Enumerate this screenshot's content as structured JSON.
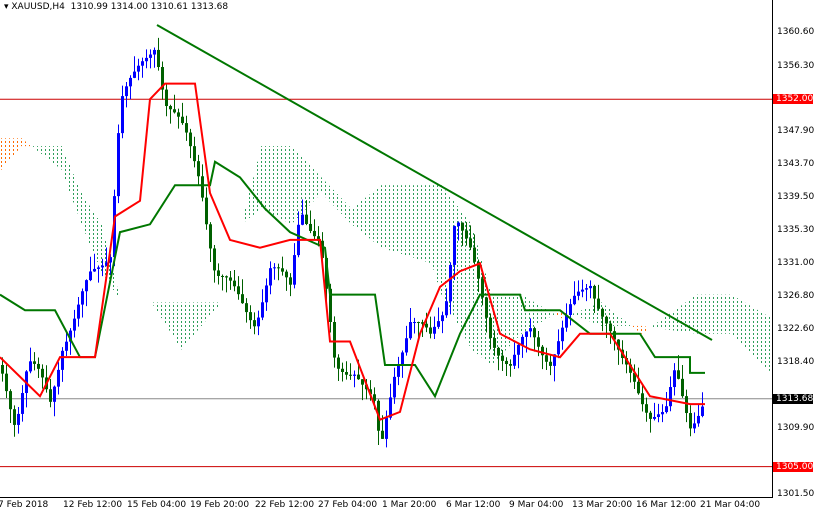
{
  "header": {
    "symbol": "XAUUSD,H4",
    "ohlc": "1310.99 1314.00 1310.61 1313.68"
  },
  "chart_data": {
    "type": "candlestick",
    "title": "XAUUSD,H4",
    "ylim": [
      1301.5,
      1360.6
    ],
    "y_ticks": [
      "1360.60",
      "1356.30",
      "1347.90",
      "1343.70",
      "1339.50",
      "1335.30",
      "1331.00",
      "1326.80",
      "1322.60",
      "1318.40",
      "1309.90",
      "1301.50"
    ],
    "x_ticks": [
      "7 Feb 2018",
      "12 Feb 12:00",
      "15 Feb 04:00",
      "19 Feb 20:00",
      "22 Feb 12:00",
      "27 Feb 04:00",
      "1 Mar 20:00",
      "6 Mar 12:00",
      "9 Mar 04:00",
      "13 Mar 20:00",
      "16 Mar 12:00",
      "21 Mar 04:00"
    ],
    "levels": [
      {
        "label": "1352.00",
        "value": 1352.0,
        "color": "#ff0000"
      },
      {
        "label": "1305.00",
        "value": 1305.0,
        "color": "#ff0000"
      },
      {
        "label": "1313.68",
        "value": 1313.68,
        "color": "#000000"
      }
    ],
    "trendline": {
      "from": 1361.5,
      "to": 1321.2,
      "color": "#007700"
    },
    "price_path": [
      [
        0,
        1318
      ],
      [
        5,
        1316
      ],
      [
        15,
        1311
      ],
      [
        28,
        1318
      ],
      [
        40,
        1316
      ],
      [
        50,
        1313.5
      ],
      [
        62,
        1321
      ],
      [
        75,
        1324
      ],
      [
        90,
        1329
      ],
      [
        110,
        1333
      ],
      [
        120,
        1352
      ],
      [
        135,
        1354.5
      ],
      [
        155,
        1359.6
      ],
      [
        165,
        1352
      ],
      [
        185,
        1347
      ],
      [
        200,
        1342
      ],
      [
        215,
        1330
      ],
      [
        240,
        1326
      ],
      [
        255,
        1324
      ],
      [
        270,
        1330
      ],
      [
        290,
        1328
      ],
      [
        300,
        1339
      ],
      [
        320,
        1333
      ],
      [
        335,
        1317
      ],
      [
        355,
        1318
      ],
      [
        375,
        1312
      ],
      [
        380,
        1306
      ],
      [
        395,
        1318
      ],
      [
        410,
        1324
      ],
      [
        430,
        1321
      ],
      [
        445,
        1326
      ],
      [
        455,
        1338
      ],
      [
        470,
        1332
      ],
      [
        490,
        1322
      ],
      [
        510,
        1318
      ],
      [
        530,
        1322
      ],
      [
        550,
        1319
      ],
      [
        575,
        1326
      ],
      [
        590,
        1329
      ],
      [
        605,
        1324
      ],
      [
        620,
        1318
      ],
      [
        635,
        1316
      ],
      [
        650,
        1312
      ],
      [
        665,
        1311
      ],
      [
        675,
        1317
      ],
      [
        690,
        1311
      ],
      [
        705,
        1313.7
      ]
    ],
    "kijun": [
      [
        0,
        1327
      ],
      [
        25,
        1325
      ],
      [
        55,
        1325
      ],
      [
        80,
        1319
      ],
      [
        95,
        1319
      ],
      [
        120,
        1335
      ],
      [
        150,
        1336
      ],
      [
        175,
        1341
      ],
      [
        210,
        1341
      ],
      [
        215,
        1344
      ],
      [
        240,
        1342
      ],
      [
        265,
        1338
      ],
      [
        290,
        1335
      ],
      [
        325,
        1333
      ],
      [
        330,
        1327
      ],
      [
        375,
        1327
      ],
      [
        385,
        1318
      ],
      [
        415,
        1318
      ],
      [
        435,
        1314
      ],
      [
        460,
        1322
      ],
      [
        480,
        1327
      ],
      [
        520,
        1327
      ],
      [
        525,
        1325
      ],
      [
        560,
        1325
      ],
      [
        590,
        1322
      ],
      [
        640,
        1322
      ],
      [
        655,
        1319
      ],
      [
        690,
        1319
      ],
      [
        690,
        1317
      ],
      [
        705,
        1317
      ]
    ],
    "tenkan": [
      [
        0,
        1319
      ],
      [
        40,
        1314
      ],
      [
        60,
        1319
      ],
      [
        95,
        1319
      ],
      [
        115,
        1337
      ],
      [
        140,
        1339
      ],
      [
        150,
        1352
      ],
      [
        165,
        1354
      ],
      [
        195,
        1354
      ],
      [
        210,
        1340
      ],
      [
        230,
        1334
      ],
      [
        260,
        1333
      ],
      [
        290,
        1334
      ],
      [
        320,
        1334
      ],
      [
        330,
        1321
      ],
      [
        350,
        1321
      ],
      [
        380,
        1311
      ],
      [
        400,
        1312
      ],
      [
        420,
        1322
      ],
      [
        440,
        1328
      ],
      [
        460,
        1330
      ],
      [
        480,
        1331
      ],
      [
        500,
        1322
      ],
      [
        530,
        1320
      ],
      [
        560,
        1319
      ],
      [
        580,
        1322
      ],
      [
        610,
        1322
      ],
      [
        630,
        1318
      ],
      [
        650,
        1314
      ],
      [
        690,
        1313
      ],
      [
        705,
        1313
      ]
    ],
    "cloud": [
      [
        0,
        1343,
        1347
      ],
      [
        20,
        1346,
        1347
      ],
      [
        60,
        1346,
        1343
      ],
      [
        80,
        1340,
        1336
      ],
      [
        100,
        1336,
        1330
      ],
      [
        120,
        1326,
        1326
      ],
      [
        150,
        1326,
        1326
      ],
      [
        180,
        1326,
        1320
      ],
      [
        220,
        1326,
        1326
      ],
      [
        240,
        1336,
        1336
      ],
      [
        260,
        1346,
        1338
      ],
      [
        290,
        1346,
        1336
      ],
      [
        320,
        1342,
        1340
      ],
      [
        350,
        1338,
        1336
      ],
      [
        380,
        1341,
        1333
      ],
      [
        430,
        1341,
        1331
      ],
      [
        440,
        1341,
        1327
      ],
      [
        470,
        1336,
        1320
      ],
      [
        490,
        1327,
        1318
      ],
      [
        520,
        1327,
        1322
      ],
      [
        560,
        1324,
        1325
      ],
      [
        600,
        1326,
        1323
      ],
      [
        640,
        1322,
        1323
      ],
      [
        695,
        1327,
        1322
      ],
      [
        730,
        1327,
        1322
      ],
      [
        770,
        1324,
        1317
      ]
    ]
  }
}
